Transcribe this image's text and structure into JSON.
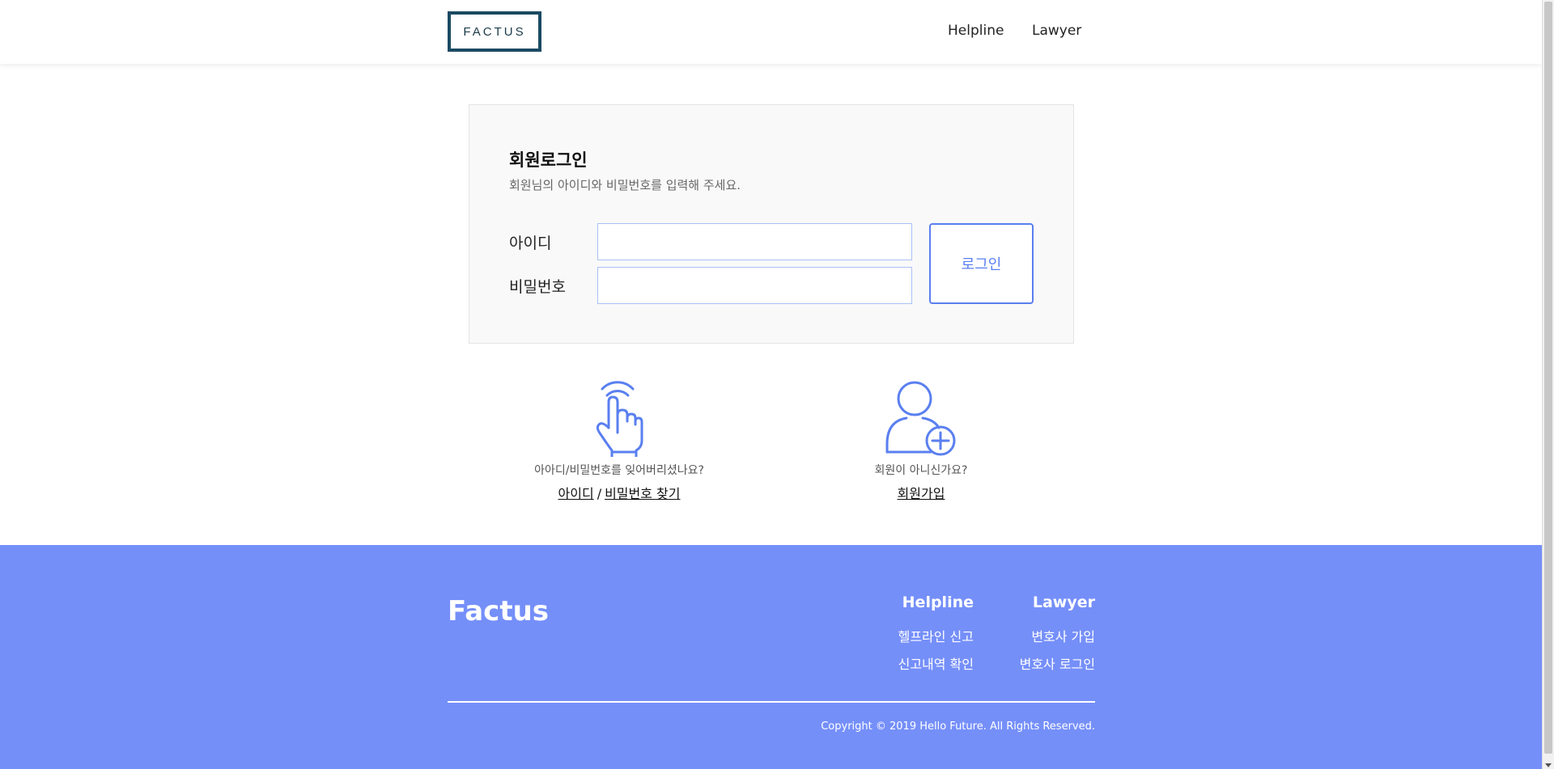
{
  "header": {
    "logo_text": "FACTUS",
    "nav": [
      {
        "label": "Helpline"
      },
      {
        "label": "Lawyer"
      }
    ]
  },
  "login": {
    "title": "회원로그인",
    "subtitle": "회원님의 아이디와 비밀번호를 입력해 주세요.",
    "id_label": "아이디",
    "id_value": "",
    "password_label": "비밀번호",
    "password_value": "",
    "submit_label": "로그인"
  },
  "helpers": {
    "find": {
      "icon": "pointer-hand-icon",
      "text": "아아디/비밀번호를 잊어버리셨나요?",
      "link_id": "아이디",
      "separator": "/",
      "link_password": "비밀번호 찾기"
    },
    "join": {
      "icon": "add-user-icon",
      "text": "회원이 아니신가요?",
      "link": "회원가입"
    }
  },
  "footer": {
    "brand": "Factus",
    "columns": [
      {
        "title": "Helpline",
        "links": [
          "헬프라인 신고",
          "신고내역 확인"
        ]
      },
      {
        "title": "Lawyer",
        "links": [
          "변호사 가입",
          "변호사 로그인"
        ]
      }
    ],
    "copyright": "Copyright © 2019 Hello Future. All Rights Reserved."
  },
  "colors": {
    "accent": "#5a7ff0",
    "footer_bg": "#758ff9",
    "logo_border": "#1b4a63"
  }
}
